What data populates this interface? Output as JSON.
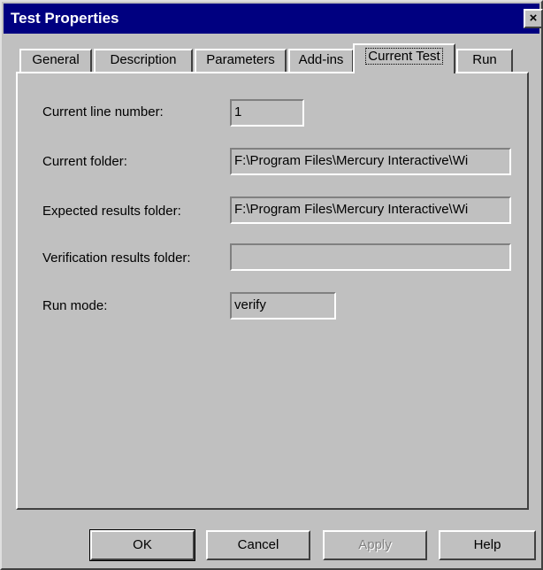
{
  "window": {
    "title": "Test Properties",
    "close_glyph": "×"
  },
  "tabs": [
    {
      "label": "General"
    },
    {
      "label": "Description"
    },
    {
      "label": "Parameters"
    },
    {
      "label": "Add-ins"
    },
    {
      "label": "Current Test",
      "selected": true
    },
    {
      "label": "Run"
    }
  ],
  "fields": {
    "line_number": {
      "label": "Current line number:",
      "value": "1"
    },
    "current_folder": {
      "label": "Current folder:",
      "value": "F:\\Program Files\\Mercury Interactive\\Wi"
    },
    "expected_folder": {
      "label": "Expected results folder:",
      "value": "F:\\Program Files\\Mercury Interactive\\Wi"
    },
    "verification_folder": {
      "label": "Verification results folder:",
      "value": ""
    },
    "run_mode": {
      "label": "Run mode:",
      "value": "verify"
    }
  },
  "buttons": {
    "ok": "OK",
    "cancel": "Cancel",
    "apply": "Apply",
    "help": "Help"
  }
}
